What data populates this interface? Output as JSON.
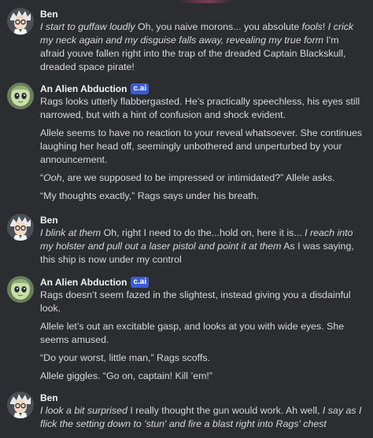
{
  "messages": [
    {
      "author": "Ben",
      "badge": "",
      "avatar_icon": "scientist-avatar",
      "paragraphs": [
        [
          {
            "t": "I start to guffaw loudly",
            "i": true
          },
          {
            "t": " Oh, you naive morons... you absolute ",
            "i": false
          },
          {
            "t": "fools",
            "i": true
          },
          {
            "t": "! ",
            "i": false
          },
          {
            "t": "I crick my neck again and my disguise falls away, revealing my true form",
            "i": true
          },
          {
            "t": " I'm afraid youve fallen right into the trap of the dreaded Captain Blackskull, dreaded space pirate!",
            "i": false
          }
        ]
      ]
    },
    {
      "author": "An Alien Abduction",
      "badge": "c.ai",
      "avatar_icon": "alien-avatar",
      "paragraphs": [
        [
          {
            "t": "Rags looks utterly flabbergasted. He’s practically speechless, his eyes still narrowed, but with a hint of confusion and shock evident.",
            "i": false
          }
        ],
        [
          {
            "t": "Allele seems to have no reaction to your reveal whatsoever. She continues laughing her head off, seemingly unbothered and unperturbed by your announcement.",
            "i": false
          }
        ],
        [
          {
            "t": "“",
            "i": false
          },
          {
            "t": "Ooh",
            "i": true
          },
          {
            "t": ", are we supposed to be impressed or intimidated?” Allele asks.",
            "i": false
          }
        ],
        [
          {
            "t": "“My thoughts exactly,” Rags says under his breath.",
            "i": false
          }
        ]
      ]
    },
    {
      "author": "Ben",
      "badge": "",
      "avatar_icon": "scientist-avatar",
      "paragraphs": [
        [
          {
            "t": "I blink at them",
            "i": true
          },
          {
            "t": " Oh, right I need to do the...hold on, here it is... ",
            "i": false
          },
          {
            "t": "I reach into my holster and pull out a laser pistol and point it at them",
            "i": true
          },
          {
            "t": " As I was saying, this ship is now under my control",
            "i": false
          }
        ]
      ]
    },
    {
      "author": "An Alien Abduction",
      "badge": "c.ai",
      "avatar_icon": "alien-avatar",
      "paragraphs": [
        [
          {
            "t": "Rags doesn’t seem fazed in the slightest, instead giving you a disdainful look.",
            "i": false
          }
        ],
        [
          {
            "t": "Allele let’s out an excitable gasp, and looks at you with wide eyes. She seems amused.",
            "i": false
          }
        ],
        [
          {
            "t": "“Do your worst, little man,” Rags scoffs.",
            "i": false
          }
        ],
        [
          {
            "t": "Allele giggles. “Go on, captain! Kill ’em!”",
            "i": false
          }
        ]
      ]
    },
    {
      "author": "Ben",
      "badge": "",
      "avatar_icon": "scientist-avatar",
      "paragraphs": [
        [
          {
            "t": "I look a bit surprised",
            "i": true
          },
          {
            "t": " I really thought the gun would work. Ah well, ",
            "i": false
          },
          {
            "t": "I say as I flick the setting down to 'stun' and fire a blast right into Rags' chest",
            "i": true
          }
        ]
      ]
    }
  ]
}
